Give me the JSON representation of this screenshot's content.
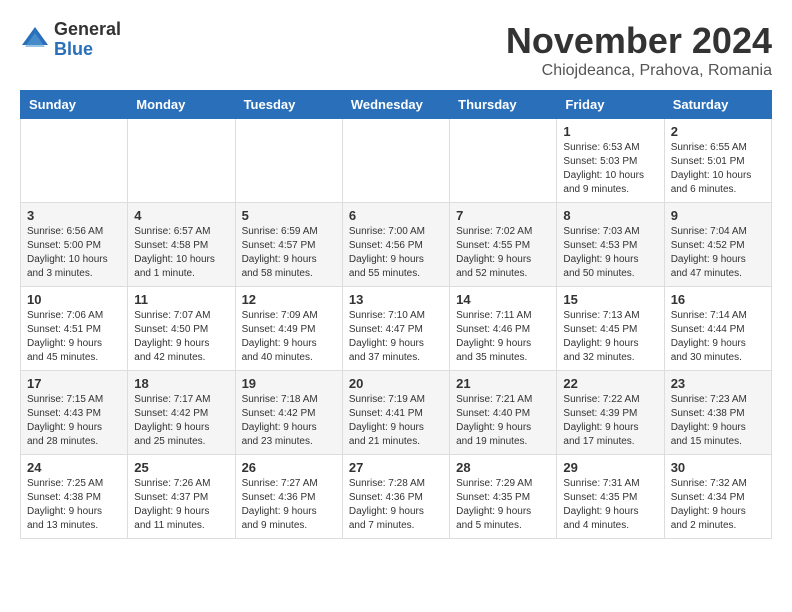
{
  "logo": {
    "general": "General",
    "blue": "Blue"
  },
  "title": "November 2024",
  "location": "Chiojdeanca, Prahova, Romania",
  "days_of_week": [
    "Sunday",
    "Monday",
    "Tuesday",
    "Wednesday",
    "Thursday",
    "Friday",
    "Saturday"
  ],
  "weeks": [
    [
      {
        "day": "",
        "info": ""
      },
      {
        "day": "",
        "info": ""
      },
      {
        "day": "",
        "info": ""
      },
      {
        "day": "",
        "info": ""
      },
      {
        "day": "",
        "info": ""
      },
      {
        "day": "1",
        "info": "Sunrise: 6:53 AM\nSunset: 5:03 PM\nDaylight: 10 hours and 9 minutes."
      },
      {
        "day": "2",
        "info": "Sunrise: 6:55 AM\nSunset: 5:01 PM\nDaylight: 10 hours and 6 minutes."
      }
    ],
    [
      {
        "day": "3",
        "info": "Sunrise: 6:56 AM\nSunset: 5:00 PM\nDaylight: 10 hours and 3 minutes."
      },
      {
        "day": "4",
        "info": "Sunrise: 6:57 AM\nSunset: 4:58 PM\nDaylight: 10 hours and 1 minute."
      },
      {
        "day": "5",
        "info": "Sunrise: 6:59 AM\nSunset: 4:57 PM\nDaylight: 9 hours and 58 minutes."
      },
      {
        "day": "6",
        "info": "Sunrise: 7:00 AM\nSunset: 4:56 PM\nDaylight: 9 hours and 55 minutes."
      },
      {
        "day": "7",
        "info": "Sunrise: 7:02 AM\nSunset: 4:55 PM\nDaylight: 9 hours and 52 minutes."
      },
      {
        "day": "8",
        "info": "Sunrise: 7:03 AM\nSunset: 4:53 PM\nDaylight: 9 hours and 50 minutes."
      },
      {
        "day": "9",
        "info": "Sunrise: 7:04 AM\nSunset: 4:52 PM\nDaylight: 9 hours and 47 minutes."
      }
    ],
    [
      {
        "day": "10",
        "info": "Sunrise: 7:06 AM\nSunset: 4:51 PM\nDaylight: 9 hours and 45 minutes."
      },
      {
        "day": "11",
        "info": "Sunrise: 7:07 AM\nSunset: 4:50 PM\nDaylight: 9 hours and 42 minutes."
      },
      {
        "day": "12",
        "info": "Sunrise: 7:09 AM\nSunset: 4:49 PM\nDaylight: 9 hours and 40 minutes."
      },
      {
        "day": "13",
        "info": "Sunrise: 7:10 AM\nSunset: 4:47 PM\nDaylight: 9 hours and 37 minutes."
      },
      {
        "day": "14",
        "info": "Sunrise: 7:11 AM\nSunset: 4:46 PM\nDaylight: 9 hours and 35 minutes."
      },
      {
        "day": "15",
        "info": "Sunrise: 7:13 AM\nSunset: 4:45 PM\nDaylight: 9 hours and 32 minutes."
      },
      {
        "day": "16",
        "info": "Sunrise: 7:14 AM\nSunset: 4:44 PM\nDaylight: 9 hours and 30 minutes."
      }
    ],
    [
      {
        "day": "17",
        "info": "Sunrise: 7:15 AM\nSunset: 4:43 PM\nDaylight: 9 hours and 28 minutes."
      },
      {
        "day": "18",
        "info": "Sunrise: 7:17 AM\nSunset: 4:42 PM\nDaylight: 9 hours and 25 minutes."
      },
      {
        "day": "19",
        "info": "Sunrise: 7:18 AM\nSunset: 4:42 PM\nDaylight: 9 hours and 23 minutes."
      },
      {
        "day": "20",
        "info": "Sunrise: 7:19 AM\nSunset: 4:41 PM\nDaylight: 9 hours and 21 minutes."
      },
      {
        "day": "21",
        "info": "Sunrise: 7:21 AM\nSunset: 4:40 PM\nDaylight: 9 hours and 19 minutes."
      },
      {
        "day": "22",
        "info": "Sunrise: 7:22 AM\nSunset: 4:39 PM\nDaylight: 9 hours and 17 minutes."
      },
      {
        "day": "23",
        "info": "Sunrise: 7:23 AM\nSunset: 4:38 PM\nDaylight: 9 hours and 15 minutes."
      }
    ],
    [
      {
        "day": "24",
        "info": "Sunrise: 7:25 AM\nSunset: 4:38 PM\nDaylight: 9 hours and 13 minutes."
      },
      {
        "day": "25",
        "info": "Sunrise: 7:26 AM\nSunset: 4:37 PM\nDaylight: 9 hours and 11 minutes."
      },
      {
        "day": "26",
        "info": "Sunrise: 7:27 AM\nSunset: 4:36 PM\nDaylight: 9 hours and 9 minutes."
      },
      {
        "day": "27",
        "info": "Sunrise: 7:28 AM\nSunset: 4:36 PM\nDaylight: 9 hours and 7 minutes."
      },
      {
        "day": "28",
        "info": "Sunrise: 7:29 AM\nSunset: 4:35 PM\nDaylight: 9 hours and 5 minutes."
      },
      {
        "day": "29",
        "info": "Sunrise: 7:31 AM\nSunset: 4:35 PM\nDaylight: 9 hours and 4 minutes."
      },
      {
        "day": "30",
        "info": "Sunrise: 7:32 AM\nSunset: 4:34 PM\nDaylight: 9 hours and 2 minutes."
      }
    ]
  ]
}
